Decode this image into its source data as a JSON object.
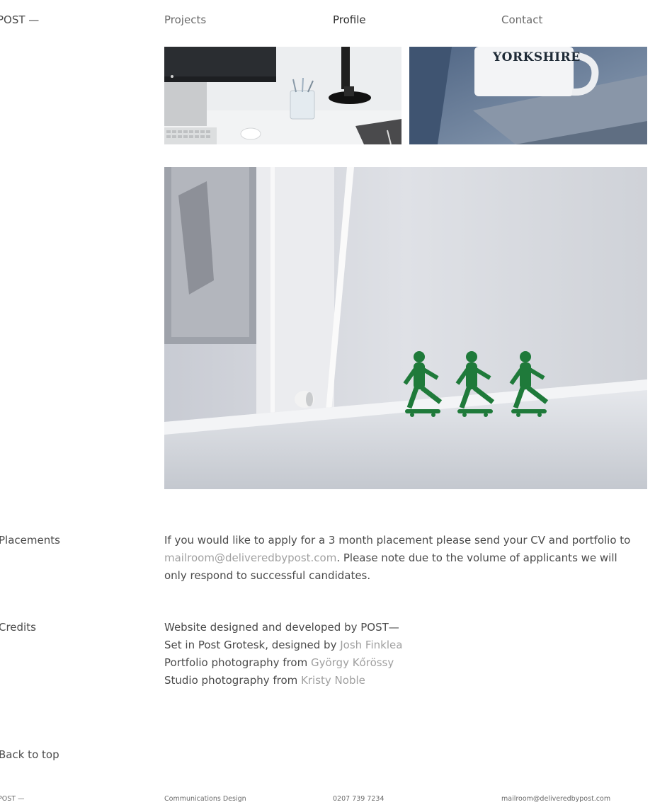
{
  "nav": {
    "logo": "POST —",
    "items": [
      {
        "label": "Projects"
      },
      {
        "label": "Profile"
      },
      {
        "label": "Contact"
      }
    ]
  },
  "photos": {
    "desk": {
      "mug_text": ""
    },
    "mug": {
      "mug_text": "YORKSHIRE"
    }
  },
  "placements": {
    "label": "Placements",
    "text_before": "If you would like to apply for a 3 month placement please send your CV and portfolio to ",
    "email": "mailroom@deliveredbypost.com",
    "text_after": ". Please note due to the volume of applicants we will only respond to successful candidates."
  },
  "credits": {
    "label": "Credits",
    "lines": [
      {
        "text": "Website designed and developed by POST—",
        "link": ""
      },
      {
        "text": "Set in Post Grotesk, designed by ",
        "link": "Josh Finklea"
      },
      {
        "text": "Portfolio photography from ",
        "link": "György Kőrössy"
      },
      {
        "text": "Studio photography from ",
        "link": "Kristy Noble"
      }
    ]
  },
  "back_to_top": "Back to top",
  "footer": {
    "logo": "POST —",
    "tagline": "Communications Design",
    "phone": "0207 739 7234",
    "email": "mailroom@deliveredbypost.com"
  }
}
